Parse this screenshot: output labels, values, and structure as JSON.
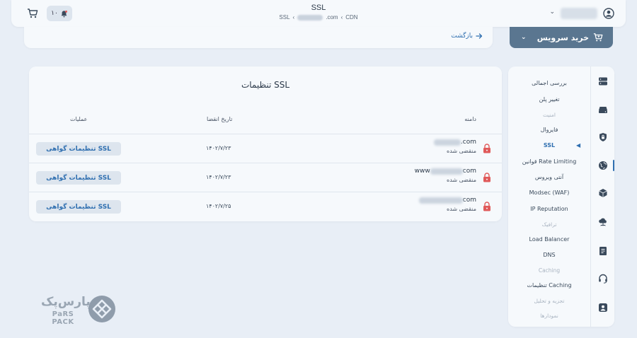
{
  "header": {
    "title": "SSL",
    "breadcrumb": [
      "CDN",
      ".com",
      "SSL"
    ],
    "notif_count": "۱۰"
  },
  "back_label": "بازگشت",
  "buy_service_label": "خرید سرویس",
  "card": {
    "title": "تنظیمات SSL",
    "columns": [
      "دامنه",
      "تاریخ انقضا",
      "عملیات"
    ],
    "rows": [
      {
        "domain_prefix": "",
        "domain_suffix": ".com",
        "status": "منقضی شده",
        "expiry": "۱۴۰۲/۷/۲۳",
        "action": "تنظیمات گواهی SSL"
      },
      {
        "domain_prefix": "www",
        "domain_suffix": "com",
        "status": "منقضی شده",
        "expiry": "۱۴۰۲/۷/۲۳",
        "action": "تنظیمات گواهی SSL"
      },
      {
        "domain_prefix": "",
        "domain_suffix": "com",
        "status": "منقضی شده",
        "expiry": "۱۴۰۲/۷/۲۵",
        "action": "تنظیمات گواهی SSL"
      }
    ]
  },
  "sidebar": {
    "items": [
      {
        "label": "بررسی اجمالی",
        "type": "item"
      },
      {
        "label": "تغییر پلن",
        "type": "item"
      },
      {
        "label": "امنیت",
        "type": "category"
      },
      {
        "label": "فایروال",
        "type": "item"
      },
      {
        "label": "SSL",
        "type": "active"
      },
      {
        "label": "قوانین Rate Limiting",
        "type": "item"
      },
      {
        "label": "آنتی ویروس",
        "type": "item"
      },
      {
        "label": "Modsec (WAF)",
        "type": "item"
      },
      {
        "label": "IP Reputation",
        "type": "item"
      },
      {
        "label": "ترافیک",
        "type": "category"
      },
      {
        "label": "Load Balancer",
        "type": "item"
      },
      {
        "label": "DNS",
        "type": "item"
      },
      {
        "label": "Caching",
        "type": "category"
      },
      {
        "label": "تنظیمات Caching",
        "type": "item"
      },
      {
        "label": "تجزیه و تحلیل",
        "type": "category"
      },
      {
        "label": "نمودارها",
        "type": "category"
      }
    ]
  },
  "logo": {
    "fa": "پارس‌پک",
    "en": "PaRS PACK"
  },
  "colors": {
    "accent": "#2f6fb0",
    "primary_button": "#5a7690",
    "danger_lock": "#e05a5a",
    "background": "#e8eef6"
  }
}
